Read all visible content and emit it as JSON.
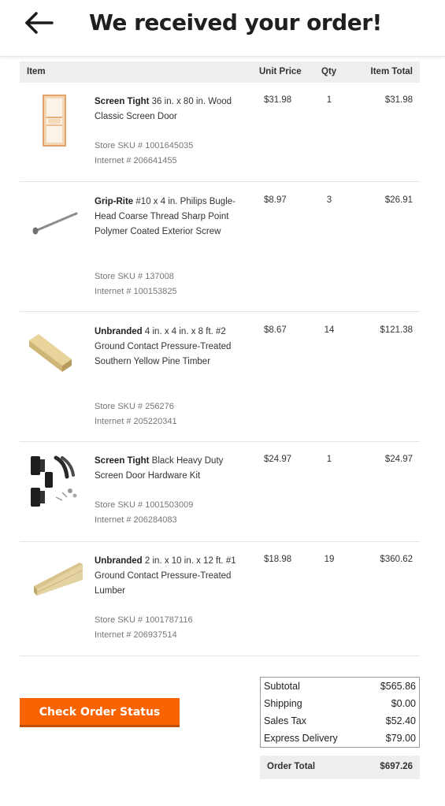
{
  "header": {
    "title": "We received your order!"
  },
  "table": {
    "headers": {
      "item": "Item",
      "unit_price": "Unit Price",
      "qty": "Qty",
      "item_total": "Item Total"
    },
    "rows": [
      {
        "brand": "Screen Tight",
        "name": " 36 in. x 80 in. Wood Classic Screen Door",
        "sku": "Store SKU # 1001645035",
        "internet": "Internet # 206641455",
        "unit_price": "$31.98",
        "qty": "1",
        "total": "$31.98",
        "image": "screen-door"
      },
      {
        "brand": "Grip-Rite",
        "name": " #10 x 4 in. Philips Bugle-Head Coarse Thread Sharp Point Polymer Coated Exterior Screw",
        "sku": "Store SKU # 137008",
        "internet": "Internet # 100153825",
        "unit_price": "$8.97",
        "qty": "3",
        "total": "$26.91",
        "image": "screw"
      },
      {
        "brand": "Unbranded",
        "name": " 4 in. x 4 in. x 8 ft. #2 Ground Contact Pressure-Treated Southern Yellow Pine Timber",
        "sku": "Store SKU # 256276",
        "internet": "Internet # 205220341",
        "unit_price": "$8.67",
        "qty": "14",
        "total": "$121.38",
        "image": "timber-post"
      },
      {
        "brand": "Screen Tight",
        "name": " Black Heavy Duty Screen Door Hardware Kit",
        "sku": "Store SKU # 1001503009",
        "internet": "Internet # 206284083",
        "unit_price": "$24.97",
        "qty": "1",
        "total": "$24.97",
        "image": "hardware-kit"
      },
      {
        "brand": "Unbranded",
        "name": " 2 in. x 10 in. x 12 ft. #1 Ground Contact Pressure-Treated Lumber",
        "sku": "Store SKU # 1001787116",
        "internet": "Internet # 206937514",
        "unit_price": "$18.98",
        "qty": "19",
        "total": "$360.62",
        "image": "lumber-board"
      }
    ]
  },
  "summary": {
    "subtotal_label": "Subtotal",
    "subtotal": "$565.86",
    "shipping_label": "Shipping",
    "shipping": "$0.00",
    "tax_label": "Sales Tax",
    "tax": "$52.40",
    "express_label": "Express Delivery",
    "express": "$79.00",
    "order_total_label": "Order Total",
    "order_total": "$697.26"
  },
  "actions": {
    "check_status": "Check Order Status"
  },
  "colors": {
    "accent": "#f96302",
    "header_bg": "#eeeeee"
  }
}
